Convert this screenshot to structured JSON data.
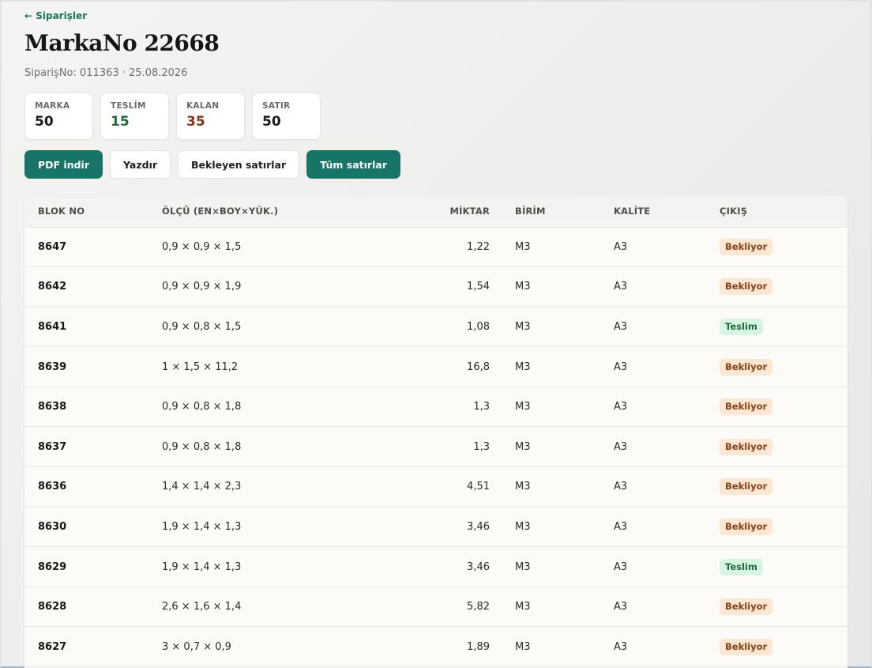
{
  "nav": {
    "back_label": "← Siparişler"
  },
  "header": {
    "title": "MarkaNo 22668",
    "subtitle": "SiparişNo: 011363 · 25.08.2026"
  },
  "stats": [
    {
      "label": "MARKA",
      "value": "50",
      "color": "#1b1b1b"
    },
    {
      "label": "TESLİM",
      "value": "15",
      "color": "#1f6e3a"
    },
    {
      "label": "KALAN",
      "value": "35",
      "color": "#8a3316"
    },
    {
      "label": "SATIR",
      "value": "50",
      "color": "#1b1b1b"
    }
  ],
  "actions": {
    "pdf_label": "PDF indir",
    "print_label": "Yazdır",
    "pending_label": "Bekleyen satırlar",
    "all_label": "Tüm satırlar"
  },
  "table": {
    "headers": {
      "blok": "BLOK NO",
      "olcu": "ÖLÇÜ (EN×BOY×YÜK.)",
      "miktar": "MİKTAR",
      "birim": "BİRİM",
      "kalite": "KALİTE",
      "cikis": "ÇIKIŞ"
    },
    "rows": [
      {
        "blok": "8647",
        "olcu": "0,9 × 0,9 × 1,5",
        "miktar": "1,22",
        "birim": "M3",
        "kalite": "A3",
        "cikis": "Bekliyor",
        "status": "wait"
      },
      {
        "blok": "8642",
        "olcu": "0,9 × 0,9 × 1,9",
        "miktar": "1,54",
        "birim": "M3",
        "kalite": "A3",
        "cikis": "Bekliyor",
        "status": "wait"
      },
      {
        "blok": "8641",
        "olcu": "0,9 × 0,8 × 1,5",
        "miktar": "1,08",
        "birim": "M3",
        "kalite": "A3",
        "cikis": "Teslim",
        "status": "done"
      },
      {
        "blok": "8639",
        "olcu": "1 × 1,5 × 11,2",
        "miktar": "16,8",
        "birim": "M3",
        "kalite": "A3",
        "cikis": "Bekliyor",
        "status": "wait"
      },
      {
        "blok": "8638",
        "olcu": "0,9 × 0,8 × 1,8",
        "miktar": "1,3",
        "birim": "M3",
        "kalite": "A3",
        "cikis": "Bekliyor",
        "status": "wait"
      },
      {
        "blok": "8637",
        "olcu": "0,9 × 0,8 × 1,8",
        "miktar": "1,3",
        "birim": "M3",
        "kalite": "A3",
        "cikis": "Bekliyor",
        "status": "wait"
      },
      {
        "blok": "8636",
        "olcu": "1,4 × 1,4 × 2,3",
        "miktar": "4,51",
        "birim": "M3",
        "kalite": "A3",
        "cikis": "Bekliyor",
        "status": "wait"
      },
      {
        "blok": "8630",
        "olcu": "1,9 × 1,4 × 1,3",
        "miktar": "3,46",
        "birim": "M3",
        "kalite": "A3",
        "cikis": "Bekliyor",
        "status": "wait"
      },
      {
        "blok": "8629",
        "olcu": "1,9 × 1,4 × 1,3",
        "miktar": "3,46",
        "birim": "M3",
        "kalite": "A3",
        "cikis": "Teslim",
        "status": "done"
      },
      {
        "blok": "8628",
        "olcu": "2,6 × 1,6 × 1,4",
        "miktar": "5,82",
        "birim": "M3",
        "kalite": "A3",
        "cikis": "Bekliyor",
        "status": "wait"
      },
      {
        "blok": "8627",
        "olcu": "3 × 0,7 × 0,9",
        "miktar": "1,89",
        "birim": "M3",
        "kalite": "A3",
        "cikis": "Bekliyor",
        "status": "wait"
      }
    ]
  }
}
